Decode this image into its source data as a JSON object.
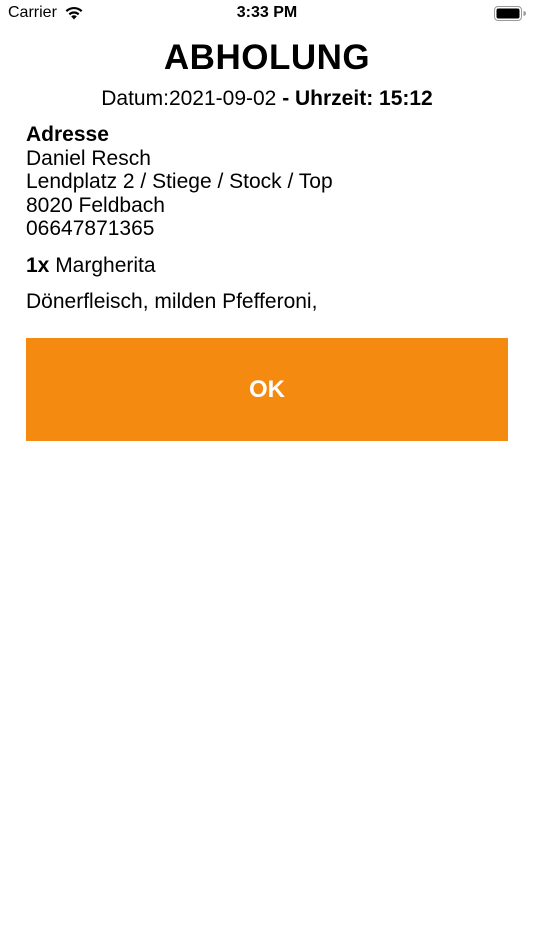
{
  "status_bar": {
    "carrier": "Carrier",
    "time": "3:33 PM"
  },
  "header": {
    "title": "ABHOLUNG",
    "date_label": "Datum:",
    "date_value": "2021-09-02",
    "time_label": " - Uhrzeit: ",
    "time_value": "15:12"
  },
  "address": {
    "heading": "Adresse",
    "name": "Daniel Resch",
    "street": "Lendplatz 2 / Stiege / Stock / Top",
    "city": "8020 Feldbach",
    "phone": "06647871365"
  },
  "order": {
    "quantity": "1x",
    "item": " Margherita",
    "extras": "Dönerfleisch, milden Pfefferoni,"
  },
  "actions": {
    "ok_label": "OK"
  },
  "colors": {
    "accent": "#f48a10"
  }
}
